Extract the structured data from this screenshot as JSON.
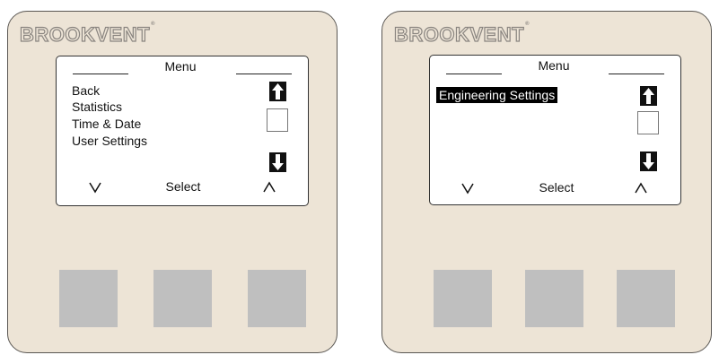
{
  "brand": {
    "name": "BROOKVENT",
    "tm": "®"
  },
  "left_device": {
    "menu_title": "Menu",
    "items": [
      "Back",
      "Statistics",
      "Time & Date",
      "User Settings"
    ],
    "softkeys": {
      "left": "down",
      "center": "Select",
      "right": "up"
    }
  },
  "right_device": {
    "menu_title": "Menu",
    "items": [
      "Engineering Settings"
    ],
    "selected_item": "Engineering Settings",
    "softkeys": {
      "left": "down",
      "center": "Select",
      "right": "up"
    }
  },
  "colors": {
    "panel": "#ede4d6",
    "screen": "#ffffff",
    "button": "#bfbfbf",
    "highlight": "#000000"
  },
  "icons": [
    "up-arrow-icon",
    "down-arrow-icon",
    "chevron-down-icon",
    "chevron-up-icon"
  ]
}
